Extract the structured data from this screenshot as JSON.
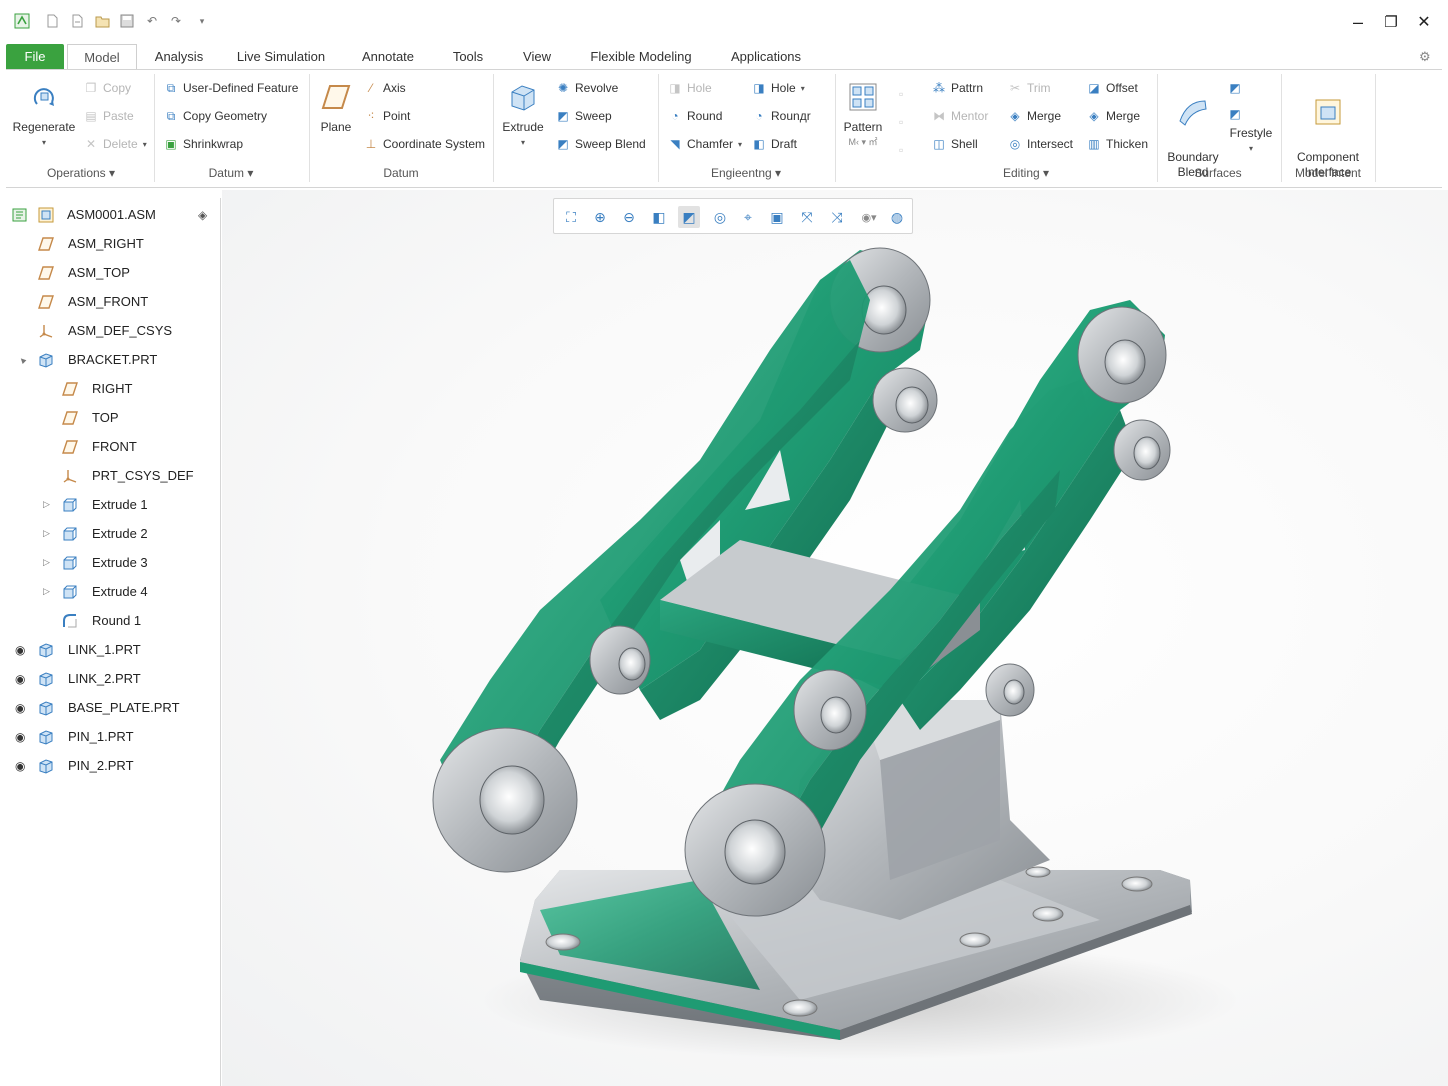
{
  "quick_access": {
    "icons": [
      "app-logo-icon",
      "new-file-icon",
      "open-file-icon",
      "folder-icon",
      "save-icon",
      "undo-icon",
      "redo-icon",
      "customize-dropdown-icon"
    ]
  },
  "window_controls": {
    "minimize": "–",
    "restore": "❐",
    "close": "✕"
  },
  "tabs": [
    {
      "label": "File"
    },
    {
      "label": "Model"
    },
    {
      "label": "Analysis"
    },
    {
      "label": "Live Simulation"
    },
    {
      "label": "Annotate"
    },
    {
      "label": "Tools"
    },
    {
      "label": "View"
    },
    {
      "label": "Flexible Modeling"
    },
    {
      "label": "Applications"
    }
  ],
  "ribbon": {
    "operations": {
      "regenerate": "Regenerate",
      "copy": "Copy",
      "paste": "Paste",
      "delete": "Delete",
      "group": "Operations"
    },
    "get_data": {
      "udf": "User-Defined Feature",
      "copy_geometry": "Copy Geometry",
      "shrinkwrap": "Shrinkwrap",
      "group": "Datum"
    },
    "datum": {
      "plane": "Plane",
      "axis": "Axis",
      "point": "Point",
      "csys": "Coordinate System",
      "group": "Datum"
    },
    "shapes": {
      "extrude": "Extrude",
      "revolve": "Revolve",
      "sweep": "Sweep",
      "sweep_blend": "Sweep Blend"
    },
    "engineering": {
      "hole1": "Hole",
      "hole2": "Hole",
      "round1": "Round",
      "round2": "Rounдr",
      "chamfer": "Chamfer",
      "draft": "Draft",
      "shell": "Shell",
      "group": "Engieentng"
    },
    "pattern": {
      "label": "Pattern",
      "sub": "M‹ ▾ ㎡"
    },
    "editing": {
      "pattern2": "Pattrn",
      "mentor": "Mentor",
      "shell": "Shell",
      "trim": "Trim",
      "merge": "Merge",
      "intersect": "Intersect",
      "offset": "Offset",
      "merge2": "Merge",
      "thicken": "Thicken",
      "group": "Editing"
    },
    "surfaces": {
      "boundary_blend": "Boundary\nBlend",
      "freestyle": "Frestyle",
      "group": "Surfaces"
    },
    "model_intent": {
      "component_interface": "Component\nInterface",
      "group": "Model Intent"
    }
  },
  "tree": {
    "root": "ASM0001.ASM",
    "items": [
      {
        "label": "ASM_RIGHT",
        "icon": "datum-plane-icon"
      },
      {
        "label": "ASM_TOP",
        "icon": "datum-plane-icon"
      },
      {
        "label": "ASM_FRONT",
        "icon": "datum-plane-icon"
      },
      {
        "label": "ASM_DEF_CSYS",
        "icon": "csys-icon"
      },
      {
        "label": "BRACKET.PRT",
        "icon": "part-icon"
      },
      {
        "label": "RIGHT",
        "icon": "datum-plane-icon"
      },
      {
        "label": "TOP",
        "icon": "datum-plane-icon"
      },
      {
        "label": "FRONT",
        "icon": "datum-plane-icon"
      },
      {
        "label": "PRT_CSYS_DEF",
        "icon": "csys-icon"
      },
      {
        "label": "Extrude 1",
        "icon": "extrude-icon"
      },
      {
        "label": "Extrude 2",
        "icon": "extrude-icon"
      },
      {
        "label": "Extrude 3",
        "icon": "extrude-icon"
      },
      {
        "label": "Extrude 4",
        "icon": "extrude-icon"
      },
      {
        "label": "Round 1",
        "icon": "round-icon"
      },
      {
        "label": "LINK_1.PRT",
        "icon": "part-icon"
      },
      {
        "label": "LINK_2.PRT",
        "icon": "part-icon"
      },
      {
        "label": "BASE_PLATE.PRT",
        "icon": "part-icon"
      },
      {
        "label": "PIN_1.PRT",
        "icon": "part-icon"
      },
      {
        "label": "PIN_2.PRT",
        "icon": "part-icon"
      }
    ]
  },
  "view_toolbar": {
    "icons": [
      "refit-icon",
      "zoom-in-icon",
      "zoom-out-icon",
      "repaint-icon",
      "shading-icon",
      "saved-orientations-icon",
      "view-manager-icon",
      "display-style-icon",
      "datum-display-icon",
      "annotation-display-icon",
      "spin-center-icon",
      "appearance-icon"
    ]
  },
  "colors": {
    "accent_green": "#3aa23f",
    "model_teal": "#1f9b73",
    "model_grey": "#aeb3b7",
    "icon_blue": "#3a7fc1"
  }
}
